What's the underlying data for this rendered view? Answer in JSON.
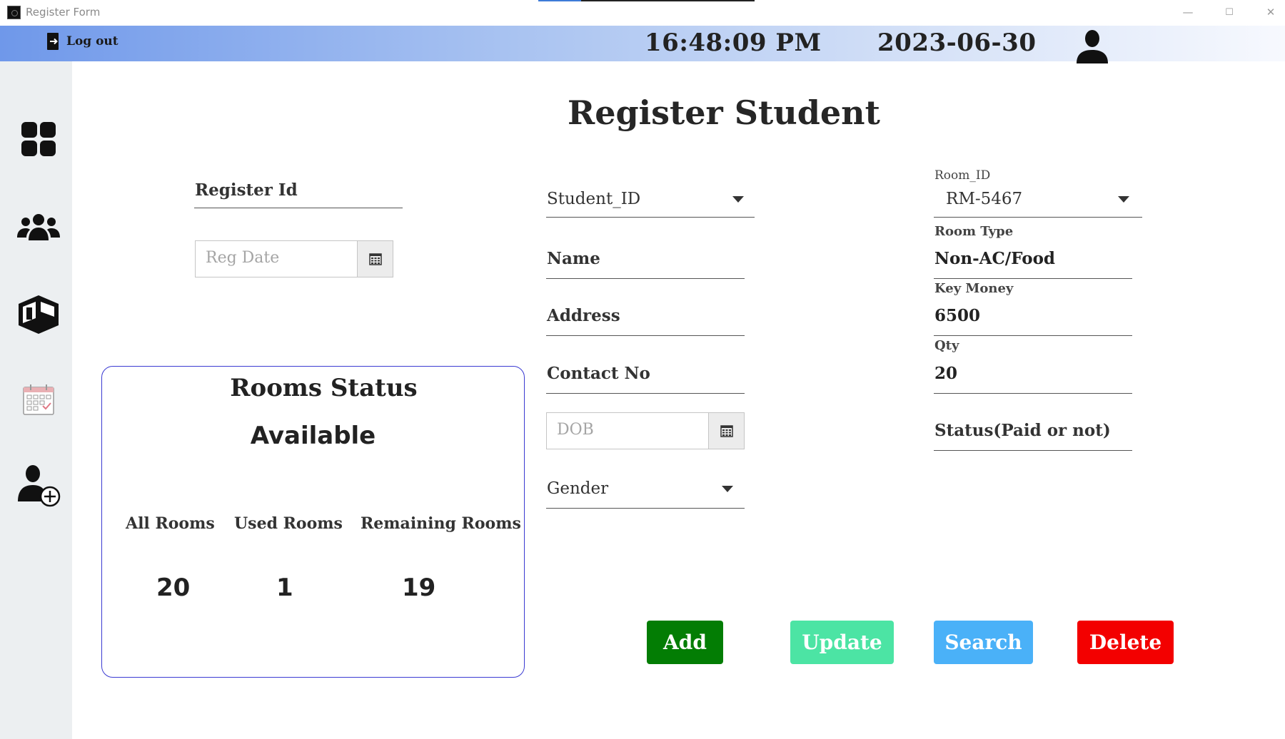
{
  "window": {
    "title": "Register Form",
    "minimize": "—",
    "maximize": "☐",
    "close": "✕"
  },
  "header": {
    "logout_label": "Log out",
    "time": "16:48:09 PM",
    "date": "2023-06-30"
  },
  "sidebar": {
    "items": [
      "dashboard-icon",
      "students-icon",
      "rooms-icon",
      "calendar-icon",
      "add-user-icon"
    ]
  },
  "page": {
    "title": "Register Student"
  },
  "form": {
    "register_id_label": "Register Id",
    "reg_date_placeholder": "Reg Date",
    "student_id_label": "Student_ID",
    "name_label": "Name",
    "address_label": "Address",
    "contact_label": "Contact No",
    "dob_placeholder": "DOB",
    "gender_label": "Gender",
    "room_id_label": "Room_ID",
    "room_id_value": "RM-5467",
    "room_type_label": "Room Type",
    "room_type_value": "Non-AC/Food",
    "key_money_label": "Key Money",
    "key_money_value": "6500",
    "qty_label": "Qty",
    "qty_value": "20",
    "status_label": "Status(Paid or not)"
  },
  "rooms_status": {
    "title": "Rooms Status",
    "subtitle": "Available",
    "all_label": "All Rooms",
    "used_label": "Used Rooms",
    "remaining_label": "Remaining Rooms",
    "all_value": "20",
    "used_value": "1",
    "remaining_value": "19"
  },
  "actions": {
    "add": "Add",
    "update": "Update",
    "search": "Search",
    "delete": "Delete"
  },
  "colors": {
    "add": "#037d04",
    "update": "#4ce4a4",
    "search": "#4ab1f8",
    "delete": "#f30000",
    "card_border": "#3a3ad2"
  }
}
